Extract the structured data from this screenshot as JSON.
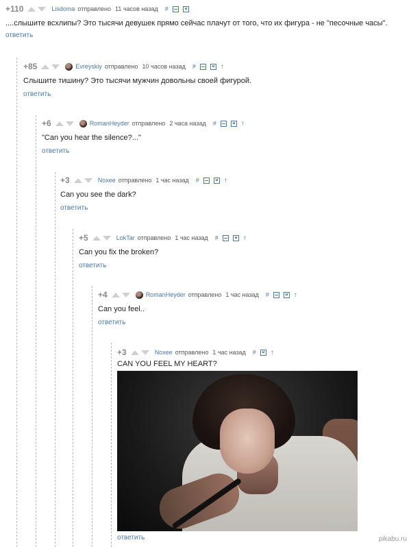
{
  "labels": {
    "sent": "отправлено",
    "reply": "ответить",
    "hash": "#"
  },
  "comments": [
    {
      "rating": "+110",
      "author": "Lisdoma",
      "time": "11 часов назад",
      "text": "....слышите всхлипы? Это тысячи девушек прямо сейчас плачут от того, что их фигура - не \"песочные часы\"."
    },
    {
      "rating": "+85",
      "author": "Evreyskiy",
      "time": "10 часов назад",
      "text": "Слышите тишину? Это тысячи мужчин довольны своей фигурой."
    },
    {
      "rating": "+6",
      "author": "RomanHeyder",
      "time": "2 часа назад",
      "text": "\"Can you hear the silence?...\""
    },
    {
      "rating": "+3",
      "author": "Noxee",
      "time": "1 час назад",
      "text": "Can you see the dark?"
    },
    {
      "rating": "+5",
      "author": "LokTar",
      "time": "1 час назад",
      "text": "Can you fix the broken?"
    },
    {
      "rating": "+4",
      "author": "RomanHeyder",
      "time": "1 час назад",
      "text": "Can you feel.."
    },
    {
      "rating": "+3",
      "author": "Noxee",
      "time": "1 час назад",
      "text": "CAN YOU FEEL MY HEART?"
    }
  ],
  "watermark": "pikabu.ru",
  "colors": {
    "link": "#4a78a8",
    "rating": "#888888",
    "vote_arrow": "#cfcfcf"
  },
  "icons": [
    "vote-up-icon",
    "vote-down-icon",
    "hash-link-icon",
    "collapse-icon",
    "save-icon",
    "parent-arrow-icon"
  ]
}
